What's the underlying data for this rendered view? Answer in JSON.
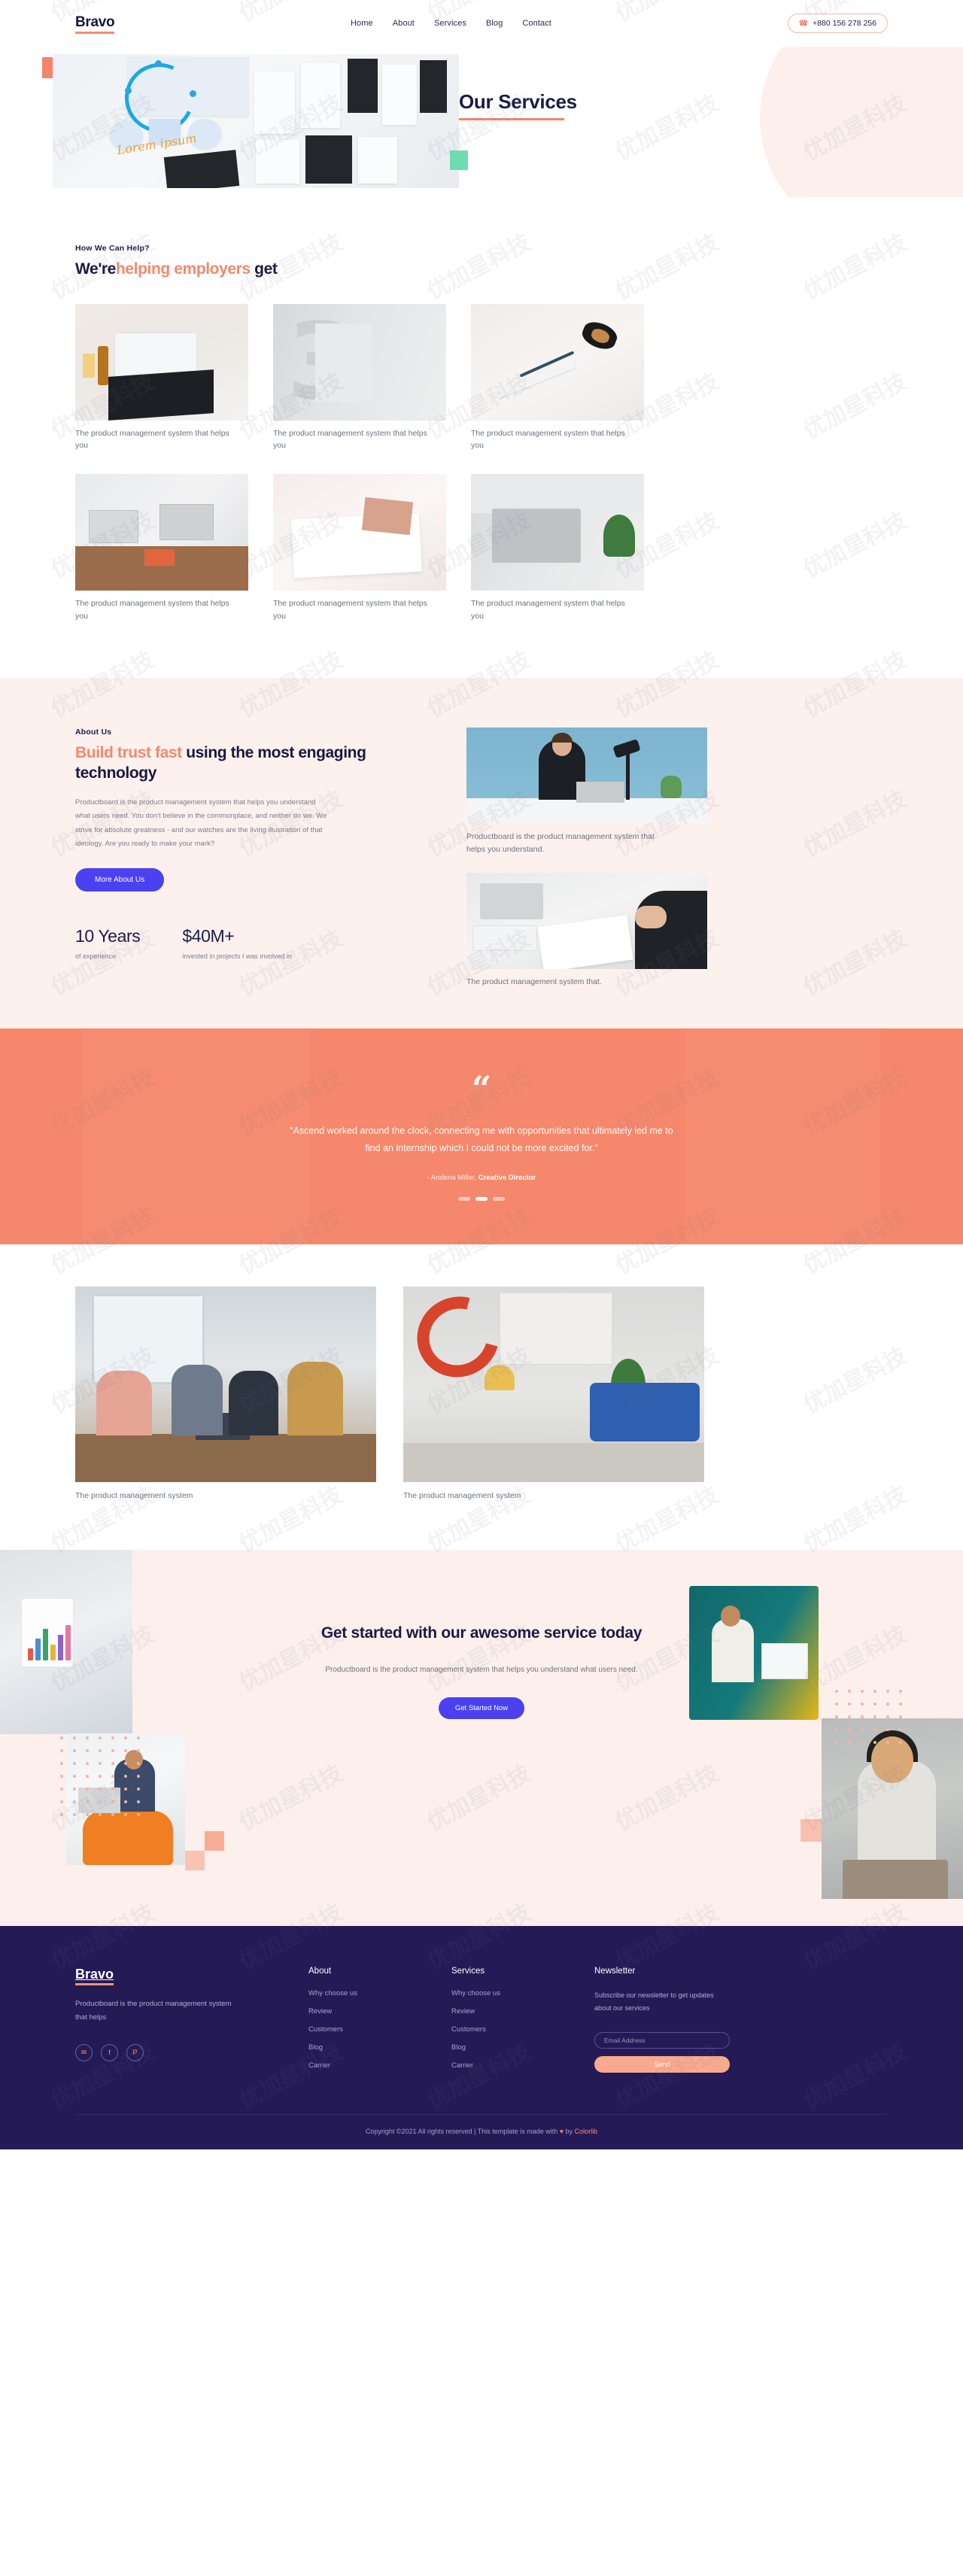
{
  "header": {
    "brand": "Bravo",
    "nav": [
      {
        "label": "Home"
      },
      {
        "label": "About"
      },
      {
        "label": "Services"
      },
      {
        "label": "Blog"
      },
      {
        "label": "Contact"
      }
    ],
    "phone_icon": "phone-icon",
    "phone": "+880 156 278 256"
  },
  "hero": {
    "title": "Our Services",
    "image_alt": "ux design workshop board"
  },
  "services": {
    "eyebrow": "How We Can Help?",
    "title_lead": "We're",
    "title_highlight": "helping employers",
    "title_tail": " get",
    "cards": [
      {
        "caption": "The product management system that helps you"
      },
      {
        "caption": "The product management system that helps you"
      },
      {
        "caption": "The product management system that helps you"
      },
      {
        "caption": "The product management system that helps you"
      },
      {
        "caption": "The product management system that helps you"
      },
      {
        "caption": "The product management system that helps you"
      }
    ]
  },
  "about": {
    "eyebrow": "About Us",
    "title_highlight": "Build trust fast",
    "title_rest": " using the most engaging technology",
    "body": "Productboard is the product management system that helps you understand what users need. You don't believe in the commonplace, and neither do we. We strive for absolute greatness - and our watches are the living illustration of that ideology. Are you ready to make your mark?",
    "button": "More About Us",
    "media": [
      {
        "caption": "Productboard is the product management system that helps you understand."
      },
      {
        "caption": "The product management system that."
      }
    ],
    "stats": [
      {
        "value": "10 Years",
        "label": "of experience"
      },
      {
        "value": "$40M+",
        "label": "invested in projects I was involved in"
      }
    ]
  },
  "testimonial": {
    "quote_icon": "quote-icon",
    "quote": "“Ascend worked around the clock, connecting me with opportunities that ultimately led me to find an internship which I could not be more excited for.”",
    "author_prefix": "- Anderia Miller, ",
    "author_role": "Creative Director",
    "dots": [
      "dot-1",
      "dot-2",
      "dot-3"
    ],
    "active_dot": 1
  },
  "gallery": {
    "items": [
      {
        "caption": "The product management system"
      },
      {
        "caption": "The product management system"
      }
    ]
  },
  "cta": {
    "title": "Get started with our awesome service today",
    "subtitle": "Productboard is the product management system that helps you understand what users need.",
    "button": "Get Started Now"
  },
  "footer": {
    "brand": "Bravo",
    "about": "Productboard is the product management system that helps",
    "socials": [
      {
        "icon": "twitter-icon",
        "glyph": "✉"
      },
      {
        "icon": "facebook-icon",
        "glyph": "f"
      },
      {
        "icon": "pinterest-icon",
        "glyph": "P"
      }
    ],
    "columns": [
      {
        "heading": "About",
        "links": [
          "Why choose us",
          "Review",
          "Customers",
          "Blog",
          "Carrier"
        ]
      },
      {
        "heading": "Services",
        "links": [
          "Why choose us",
          "Review",
          "Customers",
          "Blog",
          "Carrier"
        ]
      }
    ],
    "newsletter": {
      "heading": "Newsletter",
      "text": "Subscribe our newsletter to get updates about our services",
      "placeholder": "Email Address",
      "value": "",
      "button": "Send"
    },
    "copyright_before": "Copyright ©2021 All rights reserved | This template is made with ",
    "copyright_heart": "♥",
    "copyright_by": " by ",
    "copyright_brand": "Colorlib"
  },
  "colors": {
    "accent_coral": "#f4846b",
    "accent_blue": "#4b41f0",
    "navy": "#1b1b46",
    "footer_bg": "#241a56",
    "soft_pink": "#fdf0ec"
  },
  "watermark": "优加星科技"
}
